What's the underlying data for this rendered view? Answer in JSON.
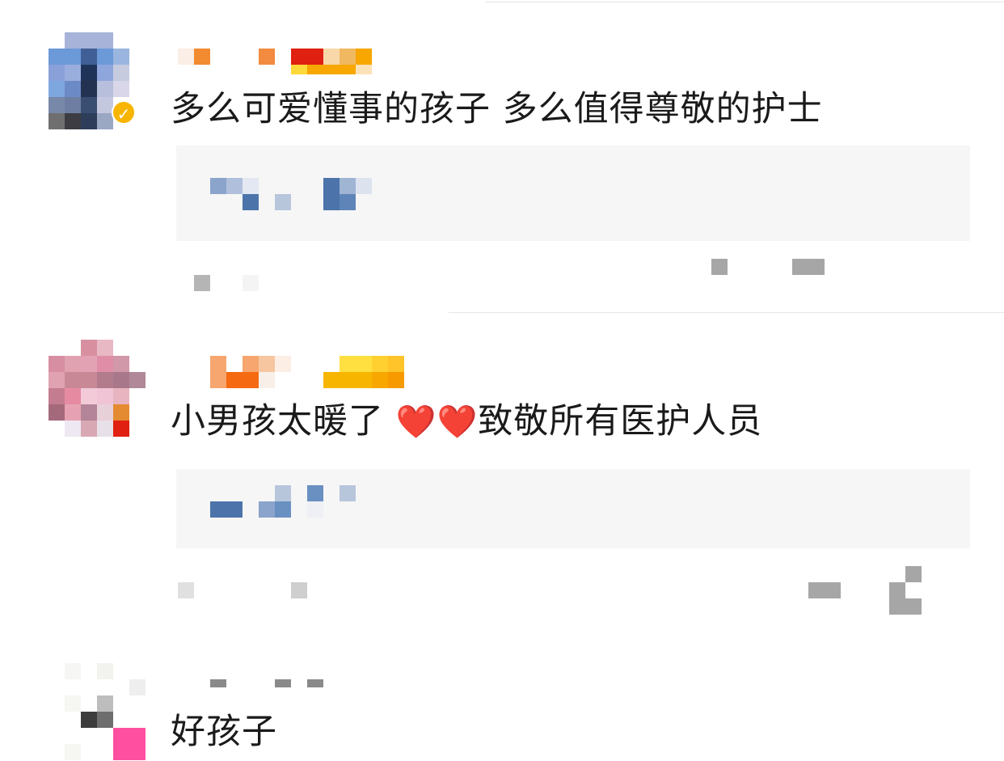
{
  "comments": [
    {
      "text": "多么可爱懂事的孩子 多么值得尊敬的护士",
      "verified": true,
      "avatar_icon": "user-avatar-icon",
      "badge_icon": "verified-badge-icon"
    },
    {
      "text_before": "小男孩太暖了",
      "emoji_1": "❤️",
      "emoji_2": "❤️",
      "text_after": "致敬所有医护人员",
      "verified": false,
      "avatar_icon": "user-avatar-icon"
    },
    {
      "text": "好孩子",
      "verified": false,
      "avatar_icon": "user-avatar-icon"
    }
  ],
  "colors": {
    "comment_text": "#1a1a1a",
    "reply_background": "#f6f6f6",
    "divider": "#e6e6e6",
    "verified_badge": "#f7b500",
    "heart": "#e02020"
  }
}
